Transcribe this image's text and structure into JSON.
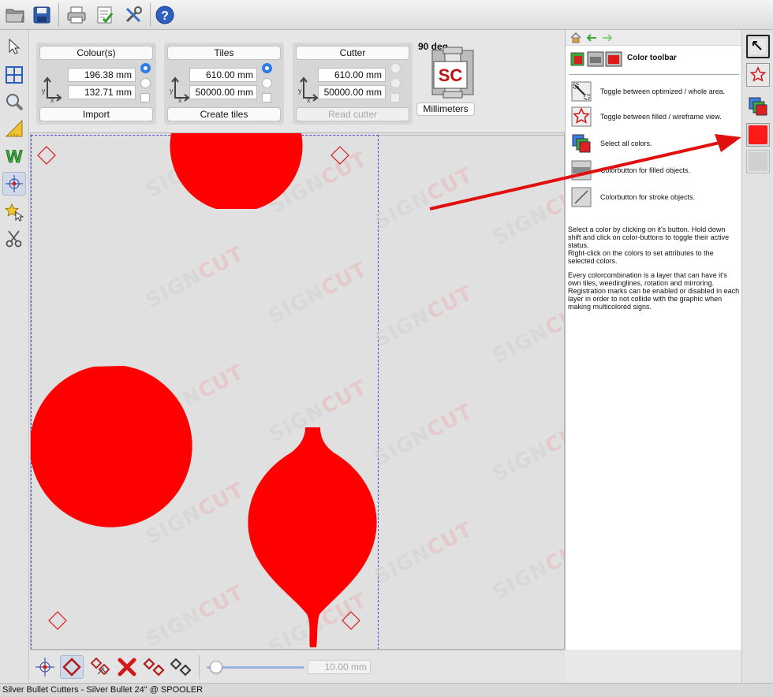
{
  "toolbar": {
    "icons": [
      "open-folder-icon",
      "save-disk-icon",
      "print-icon",
      "checklist-icon",
      "settings-tools-icon",
      "help-icon"
    ]
  },
  "left_tools": {
    "icons": [
      "pointer-icon",
      "grid-tiles-icon",
      "zoom-icon",
      "ruler-icon",
      "weed-w-icon",
      "registration-mark-icon",
      "star-select-icon",
      "scissors-icon"
    ],
    "active_index": 5
  },
  "controls": {
    "colours": {
      "title": "Colour(s)",
      "width": "196.38 mm",
      "height": "132.71 mm",
      "action": "Import"
    },
    "tiles": {
      "title": "Tiles",
      "width": "610.00 mm",
      "height": "50000.00 mm",
      "action": "Create tiles"
    },
    "cutter": {
      "title": "Cutter",
      "width": "610.00 mm",
      "height": "50000.00 mm",
      "action": "Read cutter"
    },
    "axis_x": "x",
    "axis_y": "y",
    "rotation": "90 deg",
    "logo_text": "SC",
    "units": "Millimeters"
  },
  "canvas": {
    "shape_color": "#ff0000",
    "watermark_first": "SIGN",
    "watermark_second": "CUT",
    "regmark_color": "#d81a1a"
  },
  "bottom": {
    "icons": [
      "registration-crosshair-icon",
      "regmark-diamond-icon",
      "regmark-add-icon",
      "delete-regmarks-icon",
      "regmark-pair-icon",
      "regmark-outline-icon"
    ],
    "zoom_value": "10.00 mm",
    "slider_fraction": 0.1
  },
  "status": "Silver Bullet Cutters - Silver Bullet 24\" @ SPOOLER",
  "help": {
    "title": "Color toolbar",
    "items": [
      {
        "icon": "toggle-area-icon",
        "text": "Toggle between optimized / whole area."
      },
      {
        "icon": "toggle-filled-icon",
        "text": "Toggle between filled / wireframe view."
      },
      {
        "icon": "select-all-colors-icon",
        "text": "Select all colors."
      },
      {
        "icon": "fill-colorbutton-icon",
        "text": "Colorbutton for filled objects."
      },
      {
        "icon": "stroke-colorbutton-icon",
        "text": "Colorbutton for stroke objects."
      }
    ],
    "para1": "Select a color by clicking on it's button. Hold down shift and click on color-buttons to toggle their active status.",
    "para2": "Right-click on the colors to set attributes to the selected colors.",
    "para3": "Every colorcombination is a layer that can have it's own tiles, weedinglines, rotation and mirroring. Registration marks can be enabled or disabled in each layer in order to not collide with the graphic when making multicolored signs."
  },
  "colorbar": {
    "icons": [
      "area-toggle-icon",
      "wireframe-star-icon",
      "all-colors-icon",
      "red-color-swatch-icon",
      "empty-color-swatch-icon"
    ],
    "red": "#ff1a1a"
  },
  "arrow_color": "#e01010"
}
